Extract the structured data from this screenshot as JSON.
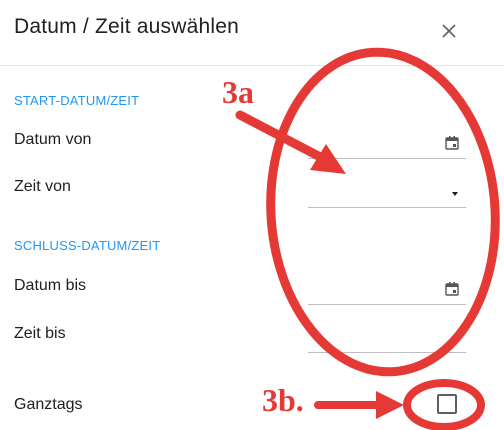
{
  "dialog": {
    "title": "Datum / Zeit auswählen",
    "close_icon": "close-icon"
  },
  "start": {
    "section_label": "START-DATUM/ZEIT",
    "date_label": "Datum von",
    "time_label": "Zeit von",
    "date_value": "",
    "time_value": ""
  },
  "end": {
    "section_label": "SCHLUSS-DATUM/ZEIT",
    "date_label": "Datum bis",
    "time_label": "Zeit bis",
    "date_value": "",
    "time_value": ""
  },
  "all_day": {
    "label": "Ganztags",
    "checked": false
  },
  "annotations": {
    "label_a": "3a",
    "label_b": "3b.",
    "color": "#e53935"
  },
  "colors": {
    "section_accent": "#2196f3",
    "text": "#202020",
    "divider": "#e4e4e4"
  },
  "icons": [
    "close-icon",
    "calendar-icon",
    "dropdown-caret-icon",
    "checkbox-icon"
  ]
}
